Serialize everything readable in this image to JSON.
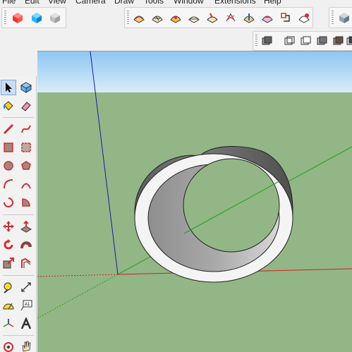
{
  "menu": [
    "File",
    "Edit",
    "View",
    "Camera",
    "Draw",
    "Tools",
    "Window",
    "Extensions",
    "Help"
  ],
  "toolbars": {
    "views": [
      "iso-view-icon",
      "top-view-icon",
      "front-view-icon"
    ],
    "sandbox": [
      "sandbox-from-contours-icon",
      "sandbox-from-scratch-icon",
      "smoove-icon",
      "stamp-icon",
      "drape-icon",
      "add-detail-icon",
      "flip-edge-icon",
      "drape-alt-icon",
      "flip-icon",
      "solid-tools-icon"
    ],
    "right_top": [
      "style-icon"
    ],
    "styles": [
      "xray-icon",
      "wireframe-icon",
      "hidden-line-icon",
      "shaded-icon",
      "shaded-textures-icon",
      "monochrome-icon"
    ]
  },
  "left_tools": [
    [
      "select-arrow-icon",
      "component-icon"
    ],
    [
      "paint-bucket-icon",
      "eraser-icon"
    ],
    [
      "line-pencil-icon",
      "freehand-icon"
    ],
    [
      "rectangle-icon",
      "rotated-rectangle-icon"
    ],
    [
      "circle-icon",
      "polygon-icon"
    ],
    [
      "arc-icon",
      "two-point-arc-icon"
    ],
    [
      "three-point-arc-icon",
      "pie-icon"
    ],
    [
      "move-icon",
      "push-pull-icon"
    ],
    [
      "rotate-icon",
      "follow-me-icon"
    ],
    [
      "scale-icon",
      "offset-icon"
    ],
    [
      "tape-measure-icon",
      "dimension-icon"
    ],
    [
      "protractor-icon",
      "text-icon"
    ],
    [
      "axes-icon",
      "3d-text-icon"
    ],
    [
      "orbit-icon",
      "pan-icon"
    ]
  ],
  "colors": {
    "sky_top": "#8ec6f2",
    "sky_bottom": "#d9ecf8",
    "ground": "#93b686",
    "axis_red": "#d22020",
    "axis_green": "#20a020",
    "axis_blue": "#1a1aa0"
  }
}
